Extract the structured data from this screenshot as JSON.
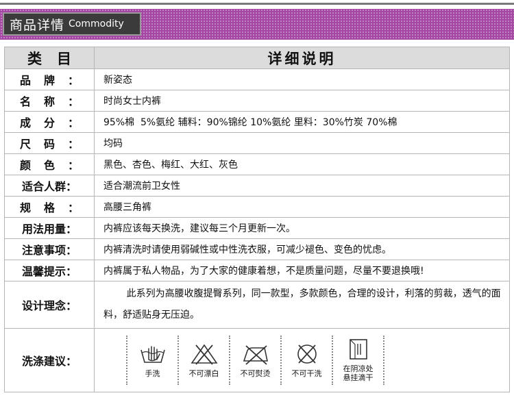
{
  "header": {
    "title_cn": "商品详情",
    "title_en": "Commodity"
  },
  "table": {
    "col1_header": "类目",
    "col2_header": "详细说明",
    "rows": [
      {
        "label": "品牌",
        "value": "新姿态"
      },
      {
        "label": "名称",
        "value": "时尚女士内裤"
      },
      {
        "label": "成分",
        "value": "95%棉  5%氨纶 辅料：90%锦纶 10%氨纶 里料：30%竹炭 70%棉"
      },
      {
        "label": "尺码",
        "value": "均码"
      },
      {
        "label": "颜色",
        "value": "黑色、杏色、梅红、大红、灰色"
      },
      {
        "label": "适合人群：",
        "value": "适合潮流前卫女性"
      },
      {
        "label": "规格",
        "value": "高腰三角裤"
      },
      {
        "label": "用法用量：",
        "value": "内裤应该每天换洗，建议每三个月更新一次。"
      },
      {
        "label": "注意事项：",
        "value": "内裤清洗时请使用弱碱性或中性洗衣服，可减少褪色、变色的忧虑。"
      },
      {
        "label": "温馨提示：",
        "value": "内裤属于私人物品，为了大家的健康着想，不是质量问题，尽量不要退换哦!"
      },
      {
        "label": "设计理念：",
        "value": "此系列为高腰收腹提臀系列，同一款型，多款颜色，合理的设计，利落的剪裁，透气的面料，舒适贴身无压迫。"
      },
      {
        "label": "洗涤建议："
      }
    ],
    "colon": "："
  },
  "wash_icons": [
    {
      "icon": "hand-wash-icon",
      "label": "手洗"
    },
    {
      "icon": "no-bleach-icon",
      "label": "不可漂白"
    },
    {
      "icon": "no-iron-icon",
      "label": "不可熨烫"
    },
    {
      "icon": "no-dry-clean-icon",
      "label": "不可干洗"
    },
    {
      "icon": "shade-dry-icon",
      "label": "在阴凉处悬挂滴干"
    }
  ],
  "colors": {
    "banner": "#a347a3",
    "tab": "#3b3b3b",
    "header_bg": "#dcdcdc",
    "border": "#b5b5b5"
  }
}
